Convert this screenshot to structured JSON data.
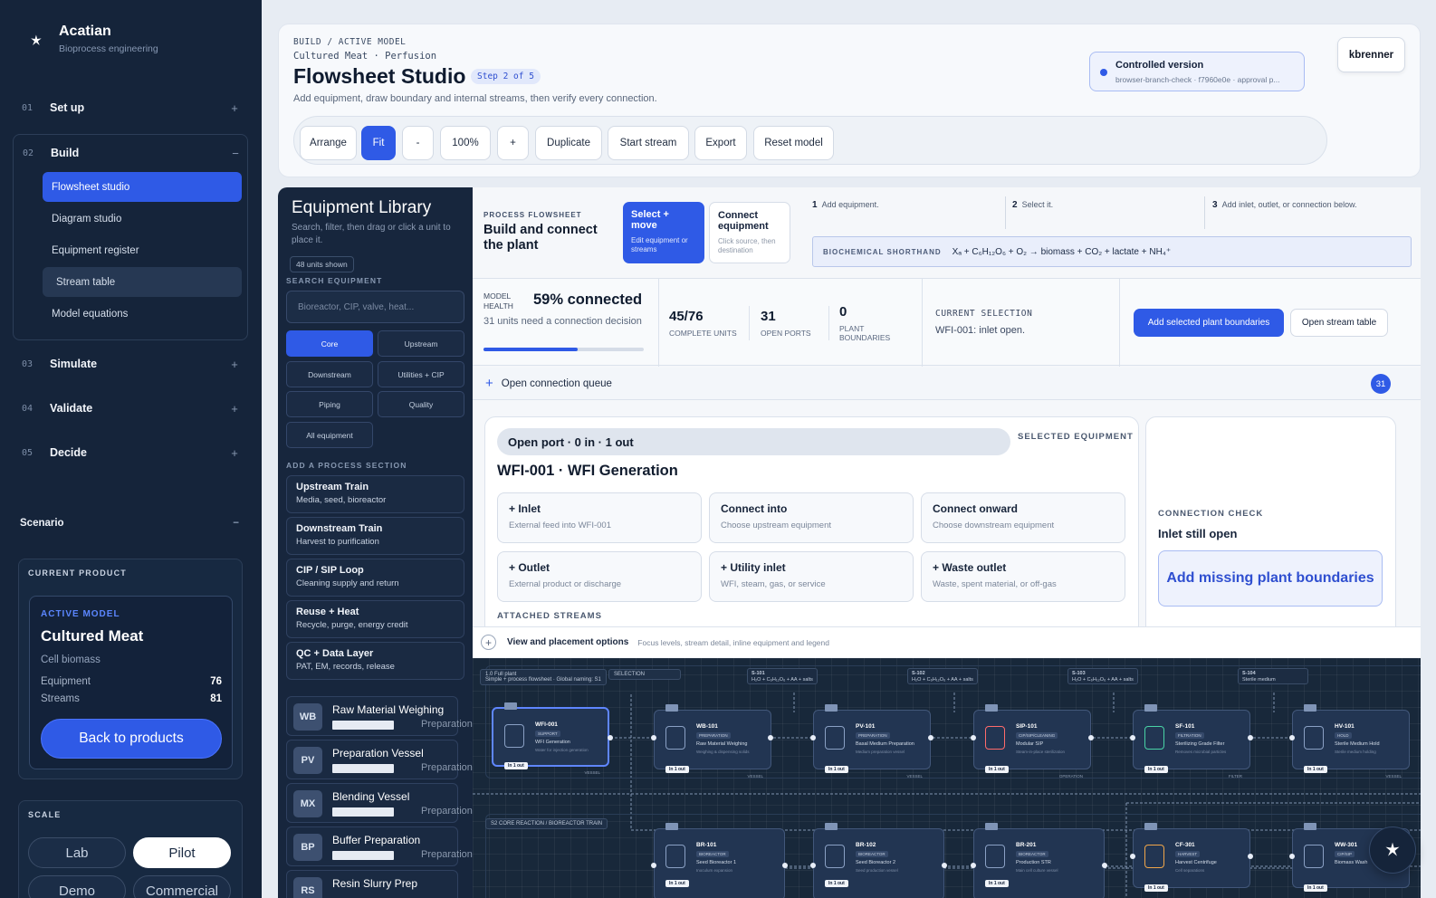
{
  "brand": {
    "name": "Acatian",
    "subtitle": "Bioprocess engineering"
  },
  "nav": {
    "steps": [
      {
        "num": "01",
        "label": "Set up",
        "toggle": "+"
      },
      {
        "num": "02",
        "label": "Build",
        "toggle": "−"
      },
      {
        "num": "03",
        "label": "Simulate",
        "toggle": "+"
      },
      {
        "num": "04",
        "label": "Validate",
        "toggle": "+"
      },
      {
        "num": "05",
        "label": "Decide",
        "toggle": "+"
      }
    ],
    "build_items": [
      "Flowsheet studio",
      "Diagram studio",
      "Equipment register",
      "Stream table",
      "Model equations"
    ]
  },
  "scenario": {
    "title": "Scenario",
    "toggle": "−",
    "current_product_caption": "CURRENT PRODUCT",
    "active_model_tag": "ACTIVE MODEL",
    "product": "Cultured Meat",
    "product_type": "Cell biomass",
    "equipment_label": "Equipment",
    "equipment_count": "76",
    "streams_label": "Streams",
    "streams_count": "81",
    "back_label": "Back to products"
  },
  "scale": {
    "caption": "SCALE",
    "options": [
      "Lab",
      "Pilot",
      "Demo",
      "Commercial"
    ],
    "selected": "Pilot"
  },
  "header": {
    "breadcrumb": "BUILD / ACTIVE MODEL",
    "context": "Cultured Meat · Perfusion",
    "title": "Flowsheet Studio",
    "step_badge": "Step 2 of 5",
    "description": "Add equipment, draw boundary and internal streams, then verify every connection.",
    "toolbar": [
      "Arrange",
      "Fit",
      "-",
      "100%",
      "+",
      "Duplicate",
      "Start stream",
      "Export",
      "Reset model"
    ],
    "version_title": "Controlled version",
    "version_sub": "browser-branch-check · f7960e0e · approval p...",
    "user": "kbrenner"
  },
  "library": {
    "title": "Equipment Library",
    "description": "Search, filter, then drag or click a unit to place it.",
    "badge": "48 units shown",
    "search_caption": "SEARCH EQUIPMENT",
    "search_placeholder": "Bioreactor, CIP, valve, heat...",
    "filters": [
      "Core",
      "Upstream",
      "Downstream",
      "Utilities + CIP",
      "Piping",
      "Quality",
      "All equipment"
    ],
    "sections_caption": "ADD A PROCESS SECTION",
    "sections": [
      {
        "title": "Upstream Train",
        "sub": "Media, seed, bioreactor"
      },
      {
        "title": "Downstream Train",
        "sub": "Harvest to purification"
      },
      {
        "title": "CIP / SIP Loop",
        "sub": "Cleaning supply and return"
      },
      {
        "title": "Reuse + Heat",
        "sub": "Recycle, purge, energy credit"
      },
      {
        "title": "QC + Data Layer",
        "sub": "PAT, EM, records, release"
      }
    ],
    "equipment": [
      {
        "abbr": "WB",
        "name": "Raw Material Weighing",
        "category": "Preparation"
      },
      {
        "abbr": "PV",
        "name": "Preparation Vessel",
        "category": "Preparation"
      },
      {
        "abbr": "MX",
        "name": "Blending Vessel",
        "category": "Preparation"
      },
      {
        "abbr": "BP",
        "name": "Buffer Preparation",
        "category": "Preparation"
      },
      {
        "abbr": "RS",
        "name": "Resin Slurry Prep",
        "category": ""
      }
    ]
  },
  "flowsheet": {
    "caption": "PROCESS FLOWSHEET",
    "title": "Build and connect the plant",
    "modes": [
      {
        "title": "Select + move",
        "sub": "Edit equipment or streams"
      },
      {
        "title": "Connect equipment",
        "sub": "Click source, then destination"
      }
    ],
    "hints": [
      {
        "n": "1",
        "text": "Add equipment."
      },
      {
        "n": "2",
        "text": "Select it."
      },
      {
        "n": "3",
        "text": "Add inlet, outlet, or connection below."
      }
    ],
    "shorthand_label": "BIOCHEMICAL SHORTHAND",
    "shorthand": "Xₐ + C₆H₁₂O₆ + O₂ → biomass + CO₂ + lactate + NH₄⁺"
  },
  "health": {
    "caption": "MODEL HEALTH",
    "percent_text": "59% connected",
    "percent": 59,
    "description": "31 units need a connection decision",
    "stats": [
      {
        "value": "45/76",
        "label": "COMPLETE UNITS"
      },
      {
        "value": "31",
        "label": "OPEN PORTS"
      },
      {
        "value": "0",
        "label": "PLANT BOUNDARIES"
      }
    ],
    "selection_caption": "CURRENT SELECTION",
    "selection": "WFI-001: inlet open.",
    "add_boundaries": "Add selected plant boundaries",
    "open_stream_table": "Open stream table"
  },
  "queue": {
    "label": "Open connection queue",
    "count": "31"
  },
  "selected": {
    "open_port": "Open port · 0 in · 1 out",
    "caption": "SELECTED EQUIPMENT",
    "name": "WFI-001 · WFI Generation",
    "actions": [
      {
        "title": "+ Inlet",
        "sub": "External feed into WFI-001"
      },
      {
        "title": "Connect into",
        "sub": "Choose upstream equipment"
      },
      {
        "title": "Connect onward",
        "sub": "Choose downstream equipment"
      },
      {
        "title": "+ Outlet",
        "sub": "External product or discharge"
      },
      {
        "title": "+ Utility inlet",
        "sub": "WFI, steam, gas, or service"
      },
      {
        "title": "+ Waste outlet",
        "sub": "Waste, spent material, or off-gas"
      }
    ],
    "attached_caption": "ATTACHED STREAMS"
  },
  "check": {
    "caption": "CONNECTION CHECK",
    "status": "Inlet still open",
    "button": "Add missing plant boundaries"
  },
  "view_options": {
    "label": "View and placement options",
    "sub": "Focus levels, stream detail, inline equipment and legend"
  },
  "canvas": {
    "lane1": "1.0 Full plant",
    "lane1_sub": "Simple + process flowsheet · Global naming: S1",
    "lane1_tag": "SELECTION",
    "lane2": "S2  CORE REACTION / BIOREACTOR TRAIN",
    "streams": [
      {
        "id": "S-101",
        "sub": "H₂O + C₆H₁₂O₆ + AA + salts"
      },
      {
        "id": "S-102",
        "sub": "H₂O + C₆H₁₂O₆ + AA + salts"
      },
      {
        "id": "S-103",
        "sub": "H₂O + C₆H₁₂O₆ + AA + salts"
      },
      {
        "id": "S-104",
        "sub": "Sterile medium"
      }
    ],
    "row1": [
      {
        "id": "WFI-001",
        "cat": "SUPPORT",
        "name": "WFI Generation",
        "desc": "Water for injection generation",
        "io": "In 1 out",
        "foot": "VESSEL"
      },
      {
        "id": "WB-101",
        "cat": "PREPARATION",
        "name": "Raw Material Weighing",
        "desc": "Weighing & dispensing solids",
        "io": "In 1 out",
        "foot": "VESSEL"
      },
      {
        "id": "PV-101",
        "cat": "PREPARATION",
        "name": "Basal Medium Preparation",
        "desc": "Medium preparation vessel",
        "io": "In 1 out",
        "foot": "VESSEL"
      },
      {
        "id": "SIP-101",
        "cat": "CIP/SIP/CLEANING",
        "name": "Modular SIP",
        "desc": "Steam-in-place sterilization",
        "io": "In 1 out",
        "foot": "OPERATION"
      },
      {
        "id": "SF-101",
        "cat": "FILTRATION",
        "name": "Sterilizing Grade Filter",
        "desc": "Removes microbial particles",
        "io": "In 1 out",
        "foot": "FILTER"
      },
      {
        "id": "HV-101",
        "cat": "HOLD",
        "name": "Sterile Medium Hold",
        "desc": "Sterile medium holding",
        "io": "In 1 out",
        "foot": "VESSEL"
      }
    ],
    "row2": [
      {
        "id": "BR-101",
        "cat": "BIOREACTOR",
        "name": "Seed Bioreactor 1",
        "desc": "Inoculum expansion",
        "io": "In 1 out"
      },
      {
        "id": "BR-102",
        "cat": "BIOREACTOR",
        "name": "Seed Bioreactor 2",
        "desc": "Seed production vessel",
        "io": "In 1 out"
      },
      {
        "id": "BR-201",
        "cat": "BIOREACTOR",
        "name": "Production STR",
        "desc": "Main cell culture vessel",
        "io": "In 1 out"
      },
      {
        "id": "CF-301",
        "cat": "HARVEST",
        "name": "Harvest Centrifuge",
        "desc": "Cell separations",
        "io": "In 1 out"
      },
      {
        "id": "WW-301",
        "cat": "CIP/SIP",
        "name": "Biomass Wash",
        "desc": "",
        "io": "In 1 out"
      }
    ]
  },
  "colors": {
    "accent": "#2f5ae6",
    "sidebar": "#15243a",
    "library": "#17263d",
    "canvas": "#18283a"
  }
}
